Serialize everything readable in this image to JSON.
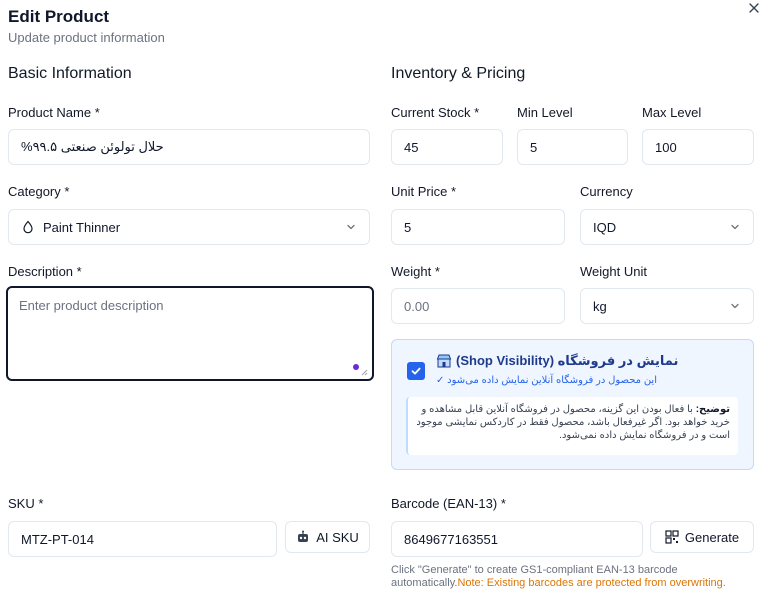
{
  "dialog": {
    "title": "Edit Product",
    "subtitle": "Update product information"
  },
  "basic": {
    "heading": "Basic Information",
    "product_name_label": "Product Name *",
    "product_name_value": "حلال تولوئن صنعتی ۹۹.۵%",
    "category_label": "Category *",
    "category_value": "Paint Thinner",
    "category_icon": "droplet-icon",
    "description_label": "Description *",
    "description_placeholder": "Enter product description"
  },
  "inventory": {
    "heading": "Inventory & Pricing",
    "current_stock_label": "Current Stock *",
    "current_stock_value": "45",
    "min_level_label": "Min Level",
    "min_level_value": "5",
    "max_level_label": "Max Level",
    "max_level_value": "100",
    "unit_price_label": "Unit Price *",
    "unit_price_value": "5",
    "currency_label": "Currency",
    "currency_value": "IQD",
    "weight_label": "Weight *",
    "weight_placeholder": "0.00",
    "weight_unit_label": "Weight Unit",
    "weight_unit_value": "kg"
  },
  "shop_visibility": {
    "checked": true,
    "title": "نمایش در فروشگاه (Shop Visibility)",
    "subtitle": "✓ این محصول در فروشگاه آنلاین نمایش داده می‌شود",
    "note_bold": "توضیح:",
    "note_text": " با فعال بودن این گزینه، محصول در فروشگاه آنلاین قابل مشاهده و خرید خواهد بود. اگر غیرفعال باشد، محصول فقط در کاردکس نمایشی موجود است و در فروشگاه نمایش داده نمی‌شود."
  },
  "sku": {
    "label": "SKU *",
    "value": "MTZ-PT-014",
    "ai_button": "AI SKU"
  },
  "barcode": {
    "label": "Barcode (EAN-13) *",
    "value": "8649677163551",
    "generate_button": "Generate",
    "hint": "Click \"Generate\" to create GS1-compliant EAN-13 barcode automatically.",
    "hint_warning": "Note: Existing barcodes are protected from overwriting."
  },
  "colors": {
    "accent": "#2563eb",
    "warning": "#d97706",
    "focus_border": "#0f172a"
  }
}
